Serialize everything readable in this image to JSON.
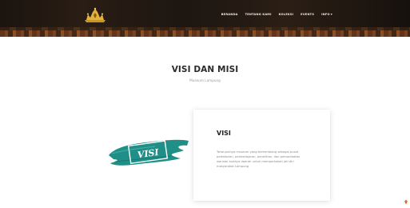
{
  "nav": {
    "items": [
      "BERANDA",
      "TENTANG KAMI",
      "KOLEKSI",
      "EVENTS",
      "INFO"
    ],
    "dropdown_icon": "chevron-down-icon"
  },
  "header": {
    "logo_icon": "museum-crown-logo"
  },
  "main": {
    "title": "VISI DAN MISI",
    "subtitle": "Museum Lampung"
  },
  "visi": {
    "image_label": "VISI",
    "card_title": "VISI",
    "card_text": "Terwujudnya museum yang berkembang sebagai pusat pelestarian, pembelajaran, penelitian, dan pemanfaatan warisan budaya daerah untuk memperkokoh jati diri masyarakat Lampung"
  },
  "colors": {
    "brush": "#1f8f88",
    "nav_text": "#f2ede6",
    "topbar": "#1b140f",
    "accent": "#e26a2c"
  },
  "icons": {
    "corner": "scroll-top-icon"
  }
}
